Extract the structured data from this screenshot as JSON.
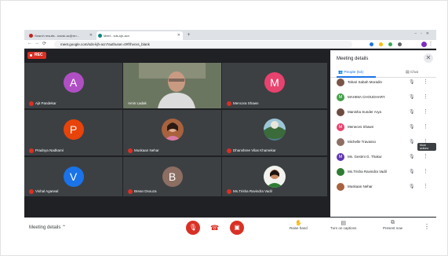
{
  "browser": {
    "tabs": [
      {
        "label": "Search results - icsrsk.ac@rrn...",
        "favicon_color": "#c5221f"
      },
      {
        "label": "Meet - sds-kjh-acn",
        "favicon_color": "#00897b"
      }
    ],
    "new_tab": "+",
    "url": "meet.google.com/sds-kjh-acn?authuser=0#frhvcvs_blank"
  },
  "meet": {
    "rec_label": "REC",
    "tiles": [
      {
        "type": "avatar",
        "letter": "A",
        "color": "#b04fc4",
        "name": "Ajit Pandekar"
      },
      {
        "type": "video",
        "name": "Amin Ladak"
      },
      {
        "type": "avatar",
        "letter": "M",
        "color": "#e8426e",
        "name": "Mencora Shawn"
      },
      {
        "type": "avatar",
        "letter": "P",
        "color": "#e8430a",
        "name": "Pradnya Nadkarni"
      },
      {
        "type": "photo",
        "color": "#a8623e",
        "name": "Muskaan Nehar"
      },
      {
        "type": "photo",
        "color": "#4f7d8f",
        "name": "Dhanshree Vilas Khamekar"
      },
      {
        "type": "avatar",
        "letter": "V",
        "color": "#1a73e8",
        "name": "Vishal Agarwal"
      },
      {
        "type": "avatar",
        "letter": "B",
        "color": "#8d6e63",
        "name": "Brean Dsouza"
      },
      {
        "type": "photo",
        "color": "#2e7d32",
        "name": "Ms.Trisha Ravindra Vadil"
      }
    ]
  },
  "panel": {
    "title": "Meeting details",
    "tab_people": "People (54)",
    "tab_chat": "Chat",
    "tooltip": "More actions",
    "participants": [
      {
        "name": "Tahari Sabah Moradin",
        "letter": "",
        "color": "#795548"
      },
      {
        "name": "MAHIMA CHOUDHARY",
        "letter": "M",
        "color": "#43a047"
      },
      {
        "name": "Manisha Sunder Arya",
        "letter": "",
        "color": "#6d4c41"
      },
      {
        "name": "Meneces Shawn",
        "letter": "M",
        "color": "#e8426e"
      },
      {
        "name": "Michelle Travasso",
        "letter": "",
        "color": "#8d6e63"
      },
      {
        "name": "Ms. Gestmi G. Thakur",
        "letter": "M",
        "color": "#5e35b1"
      },
      {
        "name": "Ms.Trisha Ravindra Vadil",
        "letter": "",
        "color": "#2e7d32"
      },
      {
        "name": "Muskaan Nehar",
        "letter": "",
        "color": "#a8623e"
      }
    ]
  },
  "bottombar": {
    "meeting_details": "Meeting details",
    "raise_hand": "Raise hand",
    "captions": "Turn on captions",
    "present": "Present now"
  }
}
